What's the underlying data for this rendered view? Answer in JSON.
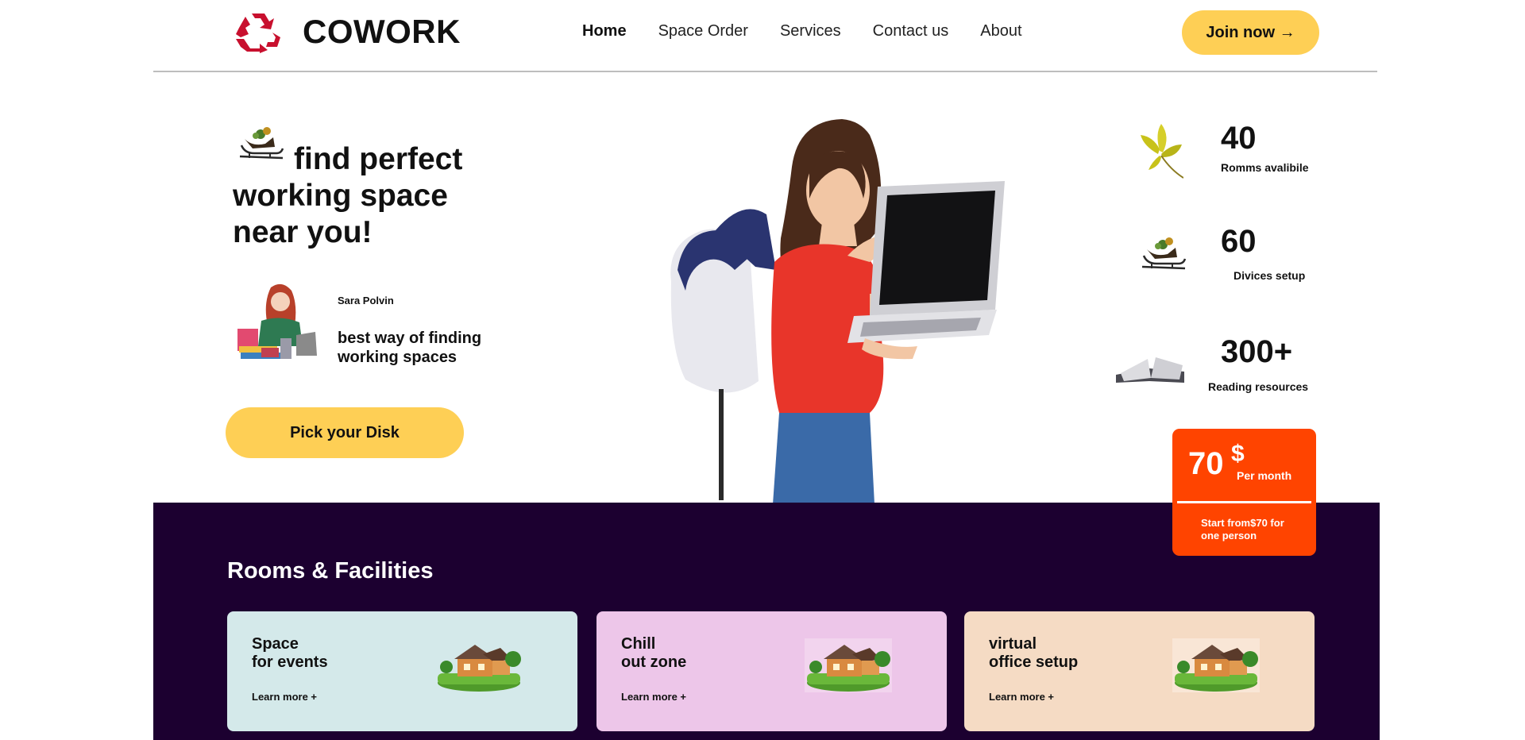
{
  "header": {
    "logo_text": "COWORK",
    "nav": [
      {
        "label": "Home",
        "active": true
      },
      {
        "label": "Space Order",
        "active": false
      },
      {
        "label": "Services",
        "active": false
      },
      {
        "label": "Contact us",
        "active": false
      },
      {
        "label": "About",
        "active": false
      }
    ],
    "join_label": "Join now →"
  },
  "hero": {
    "title_line1": "find perfect",
    "title_line2": "working space",
    "title_line3": "near you!",
    "testimonial": {
      "name": "Sara Polvin",
      "text": "best way of finding working spaces"
    },
    "cta_label": "Pick your Disk"
  },
  "stats": [
    {
      "value": "40",
      "label": "Romms avalibile",
      "icon": "leaf-icon"
    },
    {
      "value": "60",
      "label": "Divices setup",
      "icon": "sleigh-icon"
    },
    {
      "value": "300+",
      "label": "Reading resources",
      "icon": "book-icon"
    }
  ],
  "price": {
    "amount": "70",
    "currency": "$",
    "period": "Per month",
    "note": "Start from$70 for one person"
  },
  "rooms": {
    "title": "Rooms & Facilities",
    "cards": [
      {
        "title_line1": "Space",
        "title_line2": "for events",
        "link": "Learn more +",
        "bg": "#d4e9ea"
      },
      {
        "title_line1": "Chill",
        "title_line2": "out zone",
        "link": "Learn more +",
        "bg": "#edc6e9"
      },
      {
        "title_line1": "virtual",
        "title_line2": "office setup",
        "link": "Learn more +",
        "bg": "#f5dbc4"
      }
    ]
  },
  "colors": {
    "accent": "#fecf55",
    "price_card": "#ff4400",
    "dark_section": "#1c0030"
  }
}
